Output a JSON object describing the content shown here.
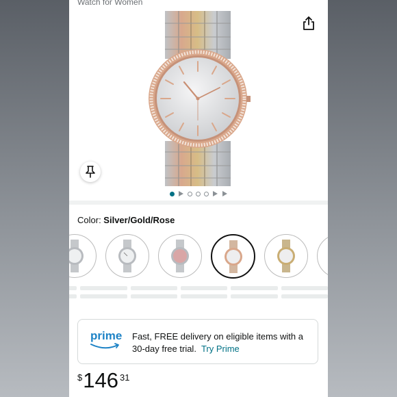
{
  "product": {
    "title": "Watch for Women"
  },
  "gallery": {
    "icons": {
      "share": "share-icon",
      "pin": "pin-icon"
    },
    "indicators": [
      "dot-active",
      "play",
      "dot",
      "dot",
      "dot",
      "play",
      "play"
    ]
  },
  "color": {
    "label": "Color: ",
    "value": "Silver/Gold/Rose"
  },
  "swatches": [
    {
      "name": "partial",
      "tone": "silver",
      "selected": false
    },
    {
      "name": "silver",
      "tone": "silver",
      "selected": false
    },
    {
      "name": "pink-dial",
      "tone": "pink",
      "selected": false
    },
    {
      "name": "silver-gold-rose",
      "tone": "rose",
      "selected": true
    },
    {
      "name": "two-tone",
      "tone": "gold",
      "selected": false
    },
    {
      "name": "rose-gold",
      "tone": "rose",
      "selected": false
    }
  ],
  "prime": {
    "logo": "prime",
    "text": "Fast, FREE delivery on eligible items with a 30-day free trial.",
    "link": "Try Prime"
  },
  "price": {
    "symbol": "$",
    "whole": "146",
    "fraction": "31"
  },
  "colors": {
    "accent_teal": "#007185",
    "prime_blue": "#1e83c6",
    "rose_gold": "#d9a78b",
    "gold": "#c9ad73"
  }
}
